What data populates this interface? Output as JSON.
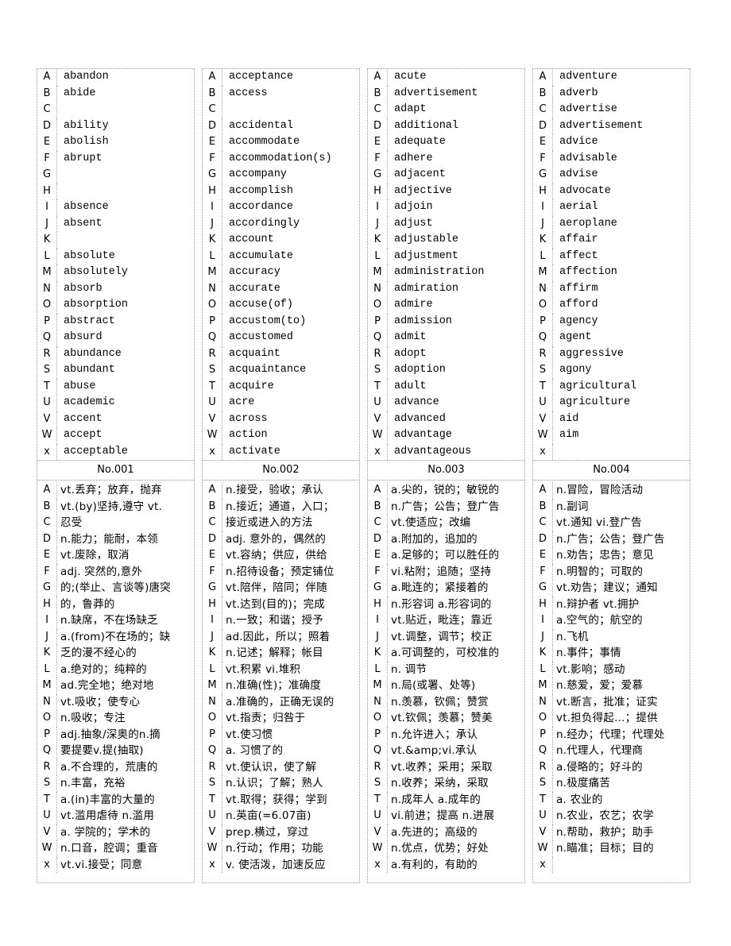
{
  "letters": [
    "A",
    "B",
    "C",
    "D",
    "E",
    "F",
    "G",
    "H",
    "I",
    "J",
    "K",
    "L",
    "M",
    "N",
    "O",
    "P",
    "Q",
    "R",
    "S",
    "T",
    "U",
    "V",
    "W",
    "x"
  ],
  "panels": [
    {
      "number": "No.001",
      "words": [
        "abandon",
        "abide",
        "",
        "ability",
        "abolish",
        "abrupt",
        "",
        "",
        "absence",
        "absent",
        "",
        "absolute",
        "absolutely",
        "absorb",
        "absorption",
        "abstract",
        "absurd",
        "abundance",
        "abundant",
        "abuse",
        "academic",
        "accent",
        "accept",
        "acceptable"
      ],
      "meanings": [
        "vt.丢弃；放弃，抛弃",
        "vt.(by)坚持,遵守 vt.",
        "忍受",
        "n.能力；能耐，本领",
        "vt.废除，取消",
        "adj. 突然的,意外",
        "的;(举止、言谈等)唐突",
        "的，鲁莽的",
        "n.缺席，不在场缺乏",
        "a.(from)不在场的；缺",
        "乏的漫不经心的",
        "a.绝对的；纯粹的",
        "ad.完全地；绝对地",
        "vt.吸收；使专心",
        "n.吸收；专注",
        "adj.抽象/深奥的n.摘",
        "要提要v.提(抽取)",
        "a.不合理的，荒唐的",
        "n.丰富，充裕",
        "a.(in)丰富的大量的",
        "vt.滥用虐待 n.滥用",
        "a.  学院的；学术的",
        "n.口音，腔调；重音",
        "vt.vi.接受；同意"
      ]
    },
    {
      "number": "No.002",
      "words": [
        "acceptance",
        "access",
        "",
        "accidental",
        "accommodate",
        "accommodation(s)",
        "accompany",
        "accomplish",
        "accordance",
        "accordingly",
        "account",
        "accumulate",
        "accuracy",
        "accurate",
        "accuse(of)",
        "accustom(to)",
        "accustomed",
        "acquaint",
        "acquaintance",
        "acquire",
        "acre",
        "across",
        "action",
        "activate"
      ],
      "meanings": [
        "n.接受，验收；承认",
        "n.接近；通道，入口；",
        "接近或进入的方法",
        "adj. 意外的，偶然的",
        "vt.容纳；供应，供给",
        "n.招待设备；预定铺位",
        "vt.陪伴，陪同；伴随",
        "vt.达到(目的)；完成",
        "n.一致；和谐；授予",
        "ad.因此，所以；照着",
        "n.记述；解释；帐目",
        "vt.积累 vi.堆积",
        "n.准确(性)；准确度",
        "a.准确的，正确无误的",
        "vt.指责；归咎于",
        "vt.使习惯",
        "a. 习惯了的",
        "vt.使认识，使了解",
        "n.认识；了解；熟人",
        "vt.取得；获得；学到",
        "n.英亩(=6.07亩)",
        "prep.横过，穿过",
        "n.行动；作用；功能",
        "v. 使活泼，加速反应"
      ]
    },
    {
      "number": "No.003",
      "words": [
        "acute",
        "advertisement",
        "adapt",
        "additional",
        "adequate",
        "adhere",
        "adjacent",
        "adjective",
        "adjoin",
        "adjust",
        "adjustable",
        "adjustment",
        "administration",
        "admiration",
        "admire",
        "admission",
        "admit",
        "adopt",
        "adoption",
        "adult",
        "advance",
        "advanced",
        "advantage",
        "advantageous"
      ],
      "meanings": [
        "a.尖的，锐的；敏锐的",
        "n.广告；公告；登广告",
        "vt.使适应；改编",
        "a.附加的，追加的",
        "a.足够的；可以胜任的",
        "vi.粘附；追随；坚持",
        "a.毗连的；紧接着的",
        "n.形容词 a.形容词的",
        "vt.贴近，毗连；靠近",
        "vt.调整，调节；校正",
        "a.可调整的，可校准的",
        "n. 调节",
        "n.局(或署、处等)",
        "n.羡慕，钦佩；赞赏",
        "vt.钦佩；羡慕；赞美",
        "n.允许进入；承认",
        "vt.&amp;vi.承认",
        "vt.收养；采用；采取",
        "n.收养；采纳，采取",
        "n.成年人 a.成年的",
        "vi.前进；提高 n.进展",
        "a.先进的；高级的",
        "n.优点，优势；好处",
        "a.有利的，有助的"
      ]
    },
    {
      "number": "No.004",
      "words": [
        "adventure",
        "adverb",
        "advertise",
        "advertisement",
        "advice",
        "advisable",
        "advise",
        "advocate",
        "aerial",
        "aeroplane",
        "affair",
        "affect",
        "affection",
        "affirm",
        "afford",
        "agency",
        "agent",
        "aggressive",
        "agony",
        "agricultural",
        "agriculture",
        " aid",
        " aim",
        ""
      ],
      "meanings": [
        "n.冒险，冒险活动",
        "n.副词",
        "vt.通知 vi.登广告",
        "n.广告；公告；登广告",
        "n.劝告；忠告；意见",
        "n.明智的；可取的",
        "vt.劝告；建议；通知",
        "n.辩护者 vt.拥护",
        "a.空气的；航空的",
        "n.飞机",
        "n.事件；事情",
        "vt.影响；感动",
        "n.慈爱，爱；爱慕",
        "vt.断言，批准；证实",
        "vt.担负得起…；提供",
        "n.经办；代理；代理处",
        "n.代理人，代理商",
        "a.侵略的；好斗的",
        "n.极度痛苦",
        "a.  农业的",
        "n.农业，农艺；农学",
        "n.帮助，救护；助手",
        "n.瞄准；目标；目的",
        ""
      ]
    }
  ]
}
